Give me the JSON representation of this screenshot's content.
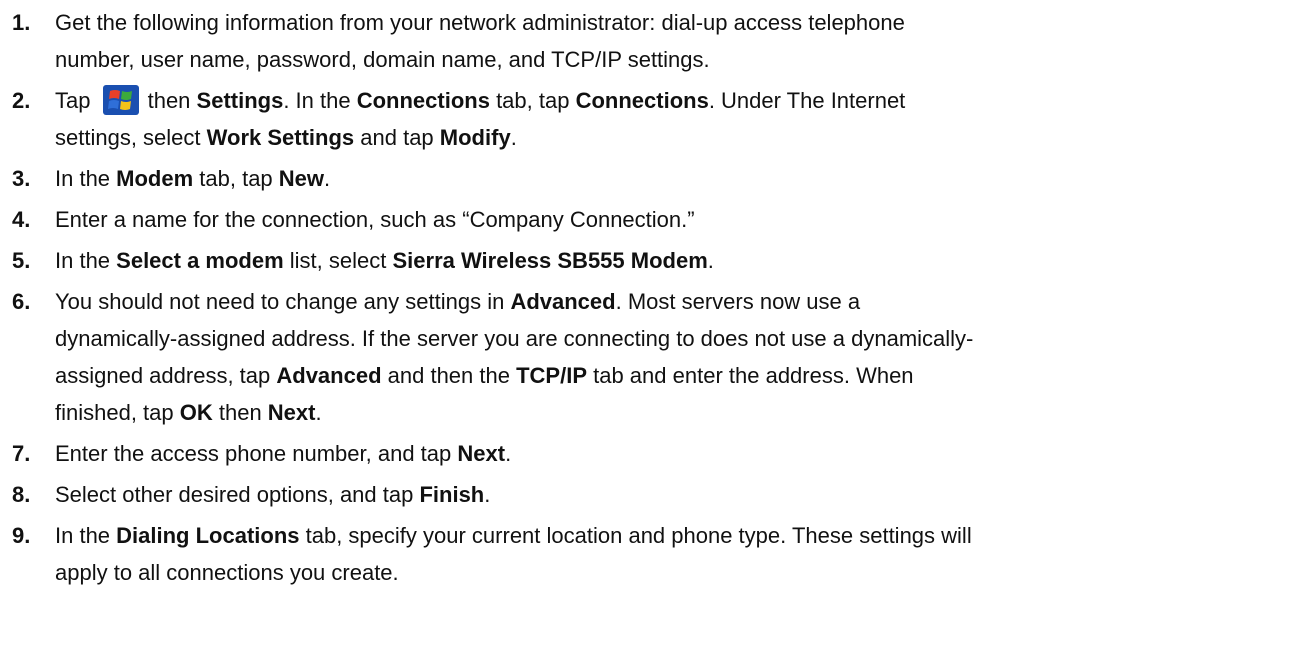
{
  "steps": [
    {
      "number": "1.",
      "lines": [
        [
          {
            "t": "Get the following information from your network administrator: dial-up access telephone"
          }
        ],
        [
          {
            "t": "number, user name, password, domain name, and TCP/IP settings."
          }
        ]
      ]
    },
    {
      "number": "2.",
      "lines": [
        [
          {
            "t": "Tap "
          },
          {
            "icon": "windows-start-icon"
          },
          {
            "t": "then "
          },
          {
            "t": "Settings",
            "b": true
          },
          {
            "t": ". In the "
          },
          {
            "t": "Connections",
            "b": true
          },
          {
            "t": " tab, tap "
          },
          {
            "t": "Connections",
            "b": true
          },
          {
            "t": ". Under The Internet"
          }
        ],
        [
          {
            "t": "settings, select "
          },
          {
            "t": "Work Settings",
            "b": true
          },
          {
            "t": " and tap "
          },
          {
            "t": "Modify",
            "b": true
          },
          {
            "t": "."
          }
        ]
      ]
    },
    {
      "number": "3.",
      "lines": [
        [
          {
            "t": "In the "
          },
          {
            "t": "Modem",
            "b": true
          },
          {
            "t": " tab, tap "
          },
          {
            "t": "New",
            "b": true
          },
          {
            "t": "."
          }
        ]
      ]
    },
    {
      "number": "4.",
      "lines": [
        [
          {
            "t": "Enter a name for the connection, such as “Company Connection.”"
          }
        ]
      ]
    },
    {
      "number": "5.",
      "lines": [
        [
          {
            "t": "In the "
          },
          {
            "t": "Select a modem",
            "b": true
          },
          {
            "t": " list, select "
          },
          {
            "t": "Sierra Wireless SB555 Modem",
            "b": true
          },
          {
            "t": "."
          }
        ]
      ]
    },
    {
      "number": "6.",
      "lines": [
        [
          {
            "t": "You should not need to change any settings in "
          },
          {
            "t": "Advanced",
            "b": true
          },
          {
            "t": ". Most servers now use a"
          }
        ],
        [
          {
            "t": "dynamically-assigned address. If the server you are connecting to does not use a dynamically-"
          }
        ],
        [
          {
            "t": "assigned address, tap "
          },
          {
            "t": "Advanced",
            "b": true
          },
          {
            "t": " and then the "
          },
          {
            "t": "TCP/IP",
            "b": true
          },
          {
            "t": " tab and enter the address. When"
          }
        ],
        [
          {
            "t": "finished, tap "
          },
          {
            "t": "OK",
            "b": true
          },
          {
            "t": " then "
          },
          {
            "t": "Next",
            "b": true
          },
          {
            "t": "."
          }
        ]
      ]
    },
    {
      "number": "7.",
      "lines": [
        [
          {
            "t": "Enter the access phone number, and tap "
          },
          {
            "t": "Next",
            "b": true
          },
          {
            "t": "."
          }
        ]
      ]
    },
    {
      "number": "8.",
      "lines": [
        [
          {
            "t": "Select other desired options, and tap "
          },
          {
            "t": "Finish",
            "b": true
          },
          {
            "t": "."
          }
        ]
      ]
    },
    {
      "number": "9.",
      "lines": [
        [
          {
            "t": "In the "
          },
          {
            "t": "Dialing Locations",
            "b": true
          },
          {
            "t": " tab, specify your current location and phone type. These settings will"
          }
        ],
        [
          {
            "t": "apply to all connections you create."
          }
        ]
      ]
    }
  ],
  "colors": {
    "text": "#111111",
    "icon_red": "#e8402a",
    "icon_green": "#3caa3c",
    "icon_blue": "#2f6fd8",
    "icon_yellow": "#f2c21a",
    "icon_bg": "#1a4fb0"
  }
}
